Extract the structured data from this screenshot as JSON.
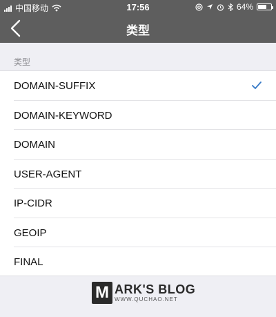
{
  "status_bar": {
    "carrier": "中国移动",
    "time": "17:56",
    "battery_percent": "64%",
    "battery_level": 0.64,
    "icons": [
      "wifi-icon",
      "at-icon",
      "location-arrow-icon",
      "alarm-icon",
      "bluetooth-icon",
      "battery-icon"
    ]
  },
  "nav": {
    "title": "类型",
    "back_icon": "chevron-left-icon"
  },
  "section": {
    "header": "类型"
  },
  "list": {
    "items": [
      {
        "label": "DOMAIN-SUFFIX",
        "selected": true
      },
      {
        "label": "DOMAIN-KEYWORD",
        "selected": false
      },
      {
        "label": "DOMAIN",
        "selected": false
      },
      {
        "label": "USER-AGENT",
        "selected": false
      },
      {
        "label": "IP-CIDR",
        "selected": false
      },
      {
        "label": "GEOIP",
        "selected": false
      },
      {
        "label": "FINAL",
        "selected": false
      }
    ],
    "check_icon": "checkmark-icon"
  },
  "watermark": {
    "logo_letter": "M",
    "title": "ARK'S BLOG",
    "url": "WWW.QUCHAO.NET"
  },
  "colors": {
    "header_bg": "#5e5e5e",
    "page_bg": "#efeff4",
    "accent": "#3478c6"
  }
}
